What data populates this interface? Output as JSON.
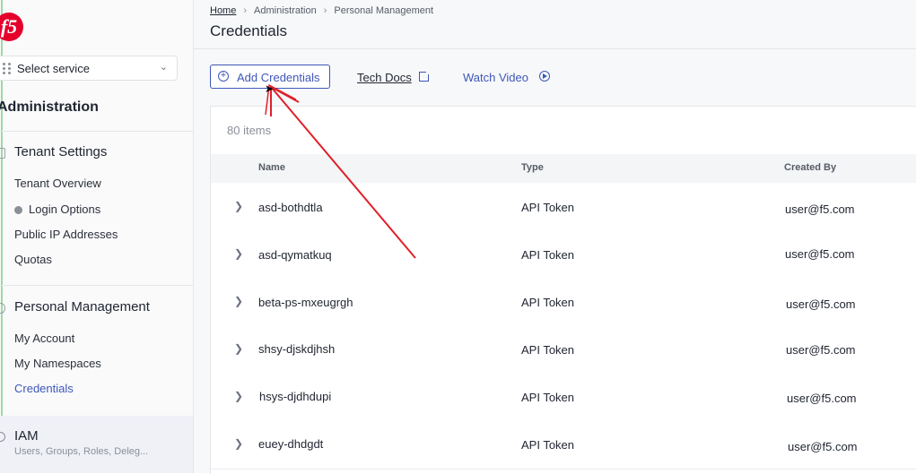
{
  "sidebar": {
    "logo_text": "f5",
    "select_service": "Select service",
    "section_title": "Administration",
    "groups": [
      {
        "title": "Tenant Settings",
        "items": [
          "Tenant Overview",
          "Login Options",
          "Public IP Addresses",
          "Quotas"
        ]
      },
      {
        "title": "Personal Management",
        "items": [
          "My Account",
          "My Namespaces",
          "Credentials"
        ]
      }
    ],
    "iam": {
      "title": "IAM",
      "subtitle": "Users, Groups, Roles, Deleg..."
    }
  },
  "header": {
    "breadcrumb": [
      "Home",
      "Administration",
      "Personal Management"
    ],
    "title": "Credentials"
  },
  "toolbar": {
    "add_label": "Add Credentials",
    "tech_docs": "Tech Docs",
    "watch_video": "Watch Video"
  },
  "table": {
    "count": "80 items",
    "columns": [
      "Name",
      "Type",
      "Created By"
    ],
    "rows": [
      {
        "name": "asd-bothdtla",
        "type": "API Token",
        "created_by": "user@f5.com"
      },
      {
        "name": "asd-qymatkuq",
        "type": "API Token",
        "created_by": "user@f5.com"
      },
      {
        "name": "beta-ps-mxeugrgh",
        "type": "API Token",
        "created_by": "user@f5.com"
      },
      {
        "name": "shsy-djskdjhsh",
        "type": "API Token",
        "created_by": "user@f5.com"
      },
      {
        "name": "hsys-djdhdupi",
        "type": "API Token",
        "created_by": "user@f5.com"
      },
      {
        "name": "euey-dhdgdt",
        "type": "API Token",
        "created_by": "user@f5.com"
      }
    ]
  },
  "colors": {
    "accent": "#3e57b8",
    "brand": "#e4002b",
    "annotation": "#e0202a"
  }
}
